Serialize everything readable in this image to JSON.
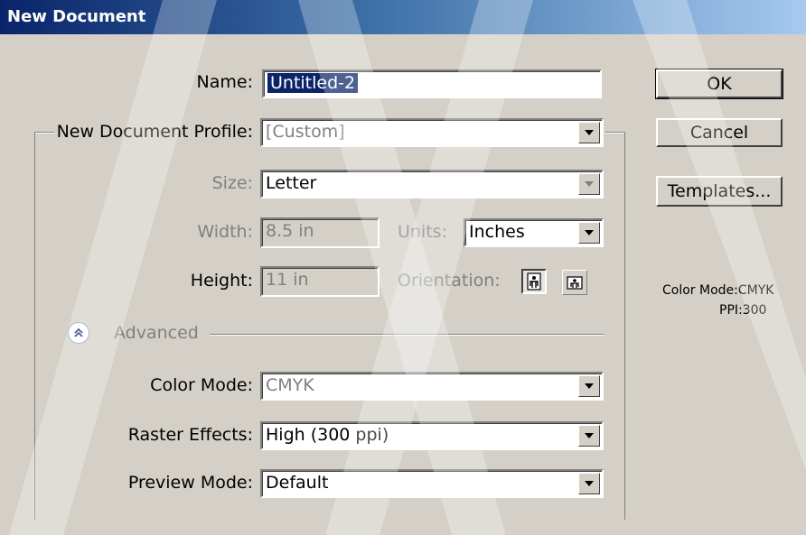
{
  "dialog": {
    "title": "New Document"
  },
  "form": {
    "name_label": "Name:",
    "name_value": "Untitled-2",
    "profile_label": "New Document Profile:",
    "profile_value": "[Custom]",
    "size_label": "Size:",
    "size_value": "Letter",
    "width_label": "Width:",
    "width_value": "8.5 in",
    "units_label": "Units:",
    "units_value": "Inches",
    "height_label": "Height:",
    "height_value": "11 in",
    "orientation_label": "Orientation:",
    "orientation_selected": "portrait"
  },
  "advanced": {
    "label": "Advanced",
    "color_mode_label": "Color Mode:",
    "color_mode_value": "CMYK",
    "raster_label": "Raster Effects:",
    "raster_value": "High (300 ppi)",
    "preview_label": "Preview Mode:",
    "preview_value": "Default"
  },
  "buttons": {
    "ok": "OK",
    "cancel": "Cancel",
    "templates": "Templates..."
  },
  "summary": {
    "color_mode": "Color Mode:CMYK",
    "ppi": "PPI:300"
  },
  "colors": {
    "face": "#d4d0c8",
    "title_start": "#0a246a",
    "title_end": "#a6caf0",
    "selection": "#0a246a"
  }
}
